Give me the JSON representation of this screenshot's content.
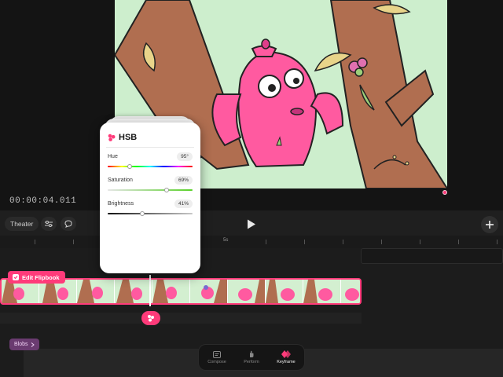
{
  "timecode": "00:00:04.011",
  "toolbar": {
    "theater_label": "Theater",
    "sliders_icon": "sliders-icon",
    "comment_icon": "comment-icon",
    "play_icon": "play-icon",
    "add_icon": "plus-icon"
  },
  "ruler": {
    "label": "5s"
  },
  "flipbook": {
    "edit_label": "Edit Flipbook",
    "frame_count": 10
  },
  "layer_tag": {
    "label": "Blobs"
  },
  "hsb": {
    "title": "HSB",
    "rows": [
      {
        "label": "Hue",
        "value": "95°",
        "level": 0.26
      },
      {
        "label": "Saturation",
        "value": "69%",
        "level": 0.69
      },
      {
        "label": "Brightness",
        "value": "41%",
        "level": 0.41
      }
    ]
  },
  "modes": [
    {
      "label": "Compose",
      "icon": "compose-icon",
      "active": false
    },
    {
      "label": "Perform",
      "icon": "perform-icon",
      "active": false
    },
    {
      "label": "Keyframe",
      "icon": "keyframe-icon",
      "active": true
    }
  ],
  "colors": {
    "accent": "#ff3b7a",
    "artwork_bg": "#cdeecd",
    "tree": "#b06e50",
    "character": "#ff5aa0"
  }
}
